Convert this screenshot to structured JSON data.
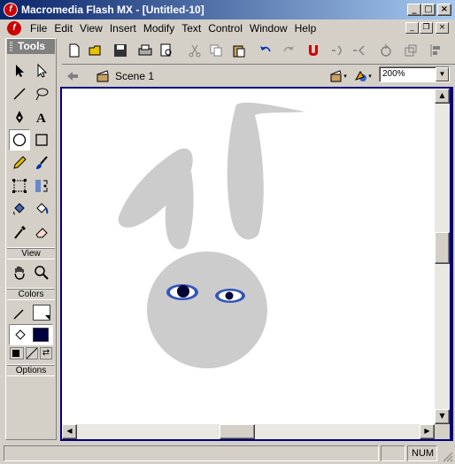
{
  "window": {
    "title": "Macromedia Flash MX - [Untitled-10]",
    "app_icon": "flash-logo-icon",
    "controls": [
      "minimize-icon",
      "maximize-icon",
      "close-icon"
    ]
  },
  "menu": {
    "items": [
      "File",
      "Edit",
      "View",
      "Insert",
      "Modify",
      "Text",
      "Control",
      "Window",
      "Help"
    ],
    "doc_controls": [
      "minimize-icon",
      "restore-icon",
      "close-icon"
    ]
  },
  "tools": {
    "title": "Tools",
    "view_label": "View",
    "colors_label": "Colors",
    "options_label": "Options",
    "selected_tool": "oval",
    "stroke_color": "#ffffff",
    "fill_color": "#000040"
  },
  "toolbar": {
    "icons": [
      "new-file-icon",
      "open-folder-icon",
      "save-icon",
      "print-icon",
      "print-preview-icon",
      "cut-icon",
      "copy-icon",
      "paste-icon",
      "undo-icon",
      "redo-icon",
      "snap-magnet-icon",
      "smooth-icon",
      "straighten-icon",
      "rotate-icon",
      "scale-icon",
      "align-icon"
    ]
  },
  "scene": {
    "label": "Scene 1",
    "zoom": "200%"
  },
  "status": {
    "num": "NUM"
  },
  "colors": {
    "stage_border": "#000080",
    "shape_gray": "#cccccc",
    "eye_blue": "#3355bb",
    "pupil": "#000033"
  }
}
